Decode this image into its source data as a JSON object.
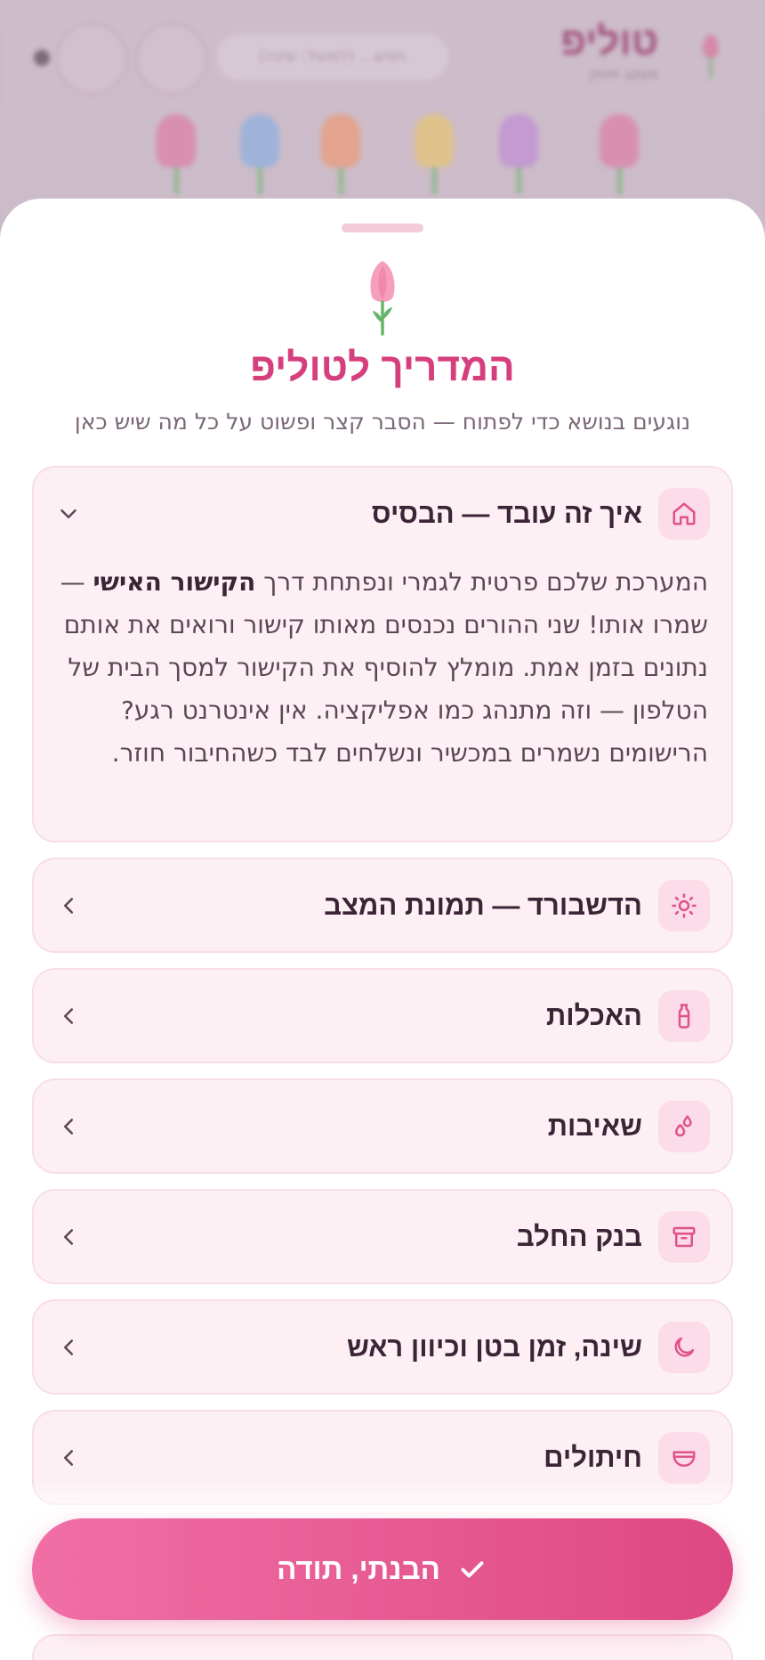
{
  "background": {
    "brand_name": "טוליפ",
    "brand_subtitle": "מעקב תינוק",
    "search_placeholder": "חפש... (למשל: שינה)"
  },
  "sheet": {
    "title": "המדריך לטוליפ",
    "subtitle": "נוגעים בנושא כדי לפתוח — הסבר קצר ופשוט על כל מה שיש כאן"
  },
  "sections": [
    {
      "title": "איך זה עובד — הבסיס",
      "icon": "home-icon",
      "expanded": true,
      "body_before": "המערכת שלכם פרטית לגמרי ונפתחת דרך ",
      "body_bold": "הקישור האישי",
      "body_after": " — שמרו אותו! שני ההורים נכנסים מאותו קישור ורואים את אותם נתונים בזמן אמת. מומלץ להוסיף את הקישור למסך הבית של הטלפון — וזה מתנהג כמו אפליקציה. אין אינטרנט רגע? הרישומים נשמרים במכשיר ונשלחים לבד כשהחיבור חוזר."
    },
    {
      "title": "הדשבורד — תמונת המצב",
      "icon": "sun-icon",
      "expanded": false
    },
    {
      "title": "האכלות",
      "icon": "bottle-icon",
      "expanded": false
    },
    {
      "title": "שאיבות",
      "icon": "droplets-icon",
      "expanded": false
    },
    {
      "title": "בנק החלב",
      "icon": "archive-box-icon",
      "expanded": false
    },
    {
      "title": "שינה, זמן בטן וכיוון ראש",
      "icon": "moon-icon",
      "expanded": false
    },
    {
      "title": "חיתולים",
      "icon": "diaper-icon",
      "expanded": false
    }
  ],
  "cta": {
    "label": "הבנתי, תודה"
  },
  "colors": {
    "accent": "#d63f7e",
    "card_bg": "#fdf0f5",
    "icon_bg": "#fbdce8",
    "cta_start": "#f06fa5",
    "cta_end": "#de4882"
  }
}
